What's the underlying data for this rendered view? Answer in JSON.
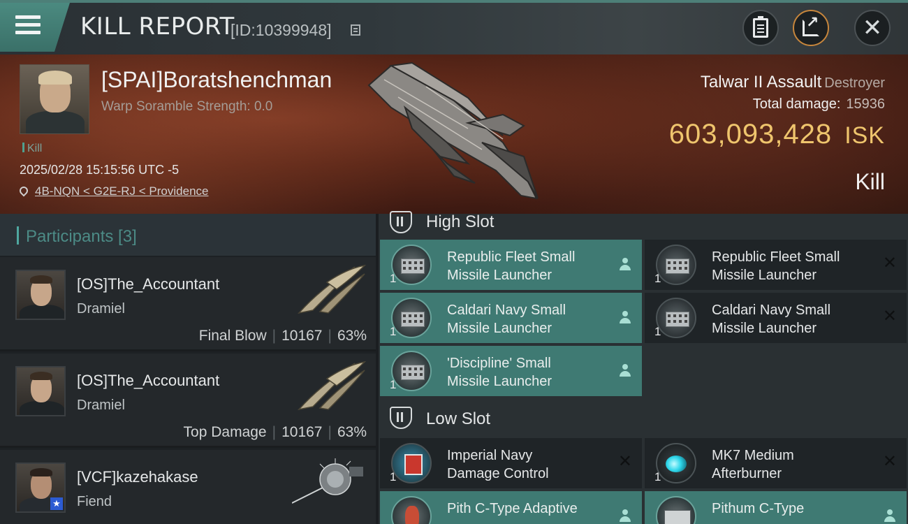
{
  "header": {
    "title": "KILL REPORT",
    "report_id": "[ID:10399948]"
  },
  "victim": {
    "name": "[SPAI]Boratshenchman",
    "scramble": "Warp Soramble Strength: 0.0",
    "tag": "Kill",
    "datetime": "2025/02/28 15:15:56 UTC -5",
    "location": "4B-NQN < G2E-RJ < Providence",
    "ship_name": "Talwar II Assault",
    "ship_class": "Destroyer",
    "total_damage_label": "Total damage:",
    "total_damage": "15936",
    "isk_value": "603,093,428",
    "isk_unit": "ISK",
    "result": "Kill"
  },
  "participants": {
    "title": "Participants [3]",
    "items": [
      {
        "name": "[OS]The_Accountant",
        "ship": "Dramiel",
        "role": "Final Blow",
        "damage": "10167",
        "percent": "63%"
      },
      {
        "name": "[OS]The_Accountant",
        "ship": "Dramiel",
        "role": "Top Damage",
        "damage": "10167",
        "percent": "63%"
      },
      {
        "name": "[VCF]kazehakase",
        "ship": "Fiend",
        "role": "",
        "damage": "",
        "percent": ""
      }
    ]
  },
  "fitting": {
    "high_slot_title": "High Slot",
    "low_slot_title": "Low Slot",
    "high_slots": [
      {
        "name_line1": "Republic Fleet Small",
        "name_line2": "Missile Launcher",
        "qty": "1",
        "status": "fitted"
      },
      {
        "name_line1": "Republic Fleet Small",
        "name_line2": "Missile Launcher",
        "qty": "1",
        "status": "destroyed"
      },
      {
        "name_line1": "Caldari Navy Small",
        "name_line2": "Missile Launcher",
        "qty": "1",
        "status": "fitted"
      },
      {
        "name_line1": "Caldari Navy Small",
        "name_line2": "Missile Launcher",
        "qty": "1",
        "status": "destroyed"
      },
      {
        "name_line1": "'Discipline' Small",
        "name_line2": "Missile Launcher",
        "qty": "1",
        "status": "fitted"
      }
    ],
    "low_slots": [
      {
        "name_line1": "Imperial Navy",
        "name_line2": "Damage Control",
        "qty": "1",
        "status": "destroyed"
      },
      {
        "name_line1": "MK7 Medium",
        "name_line2": "Afterburner",
        "qty": "1",
        "status": "destroyed"
      },
      {
        "name_line1": "Pith C-Type Adaptive",
        "name_line2": "",
        "qty": "",
        "status": "fitted"
      },
      {
        "name_line1": "Pithum C-Type",
        "name_line2": "",
        "qty": "",
        "status": "fitted"
      }
    ]
  },
  "colors": {
    "accent_teal": "#3f7a73",
    "isk_gold": "#efc56d",
    "banner_red": "#5d2819"
  }
}
